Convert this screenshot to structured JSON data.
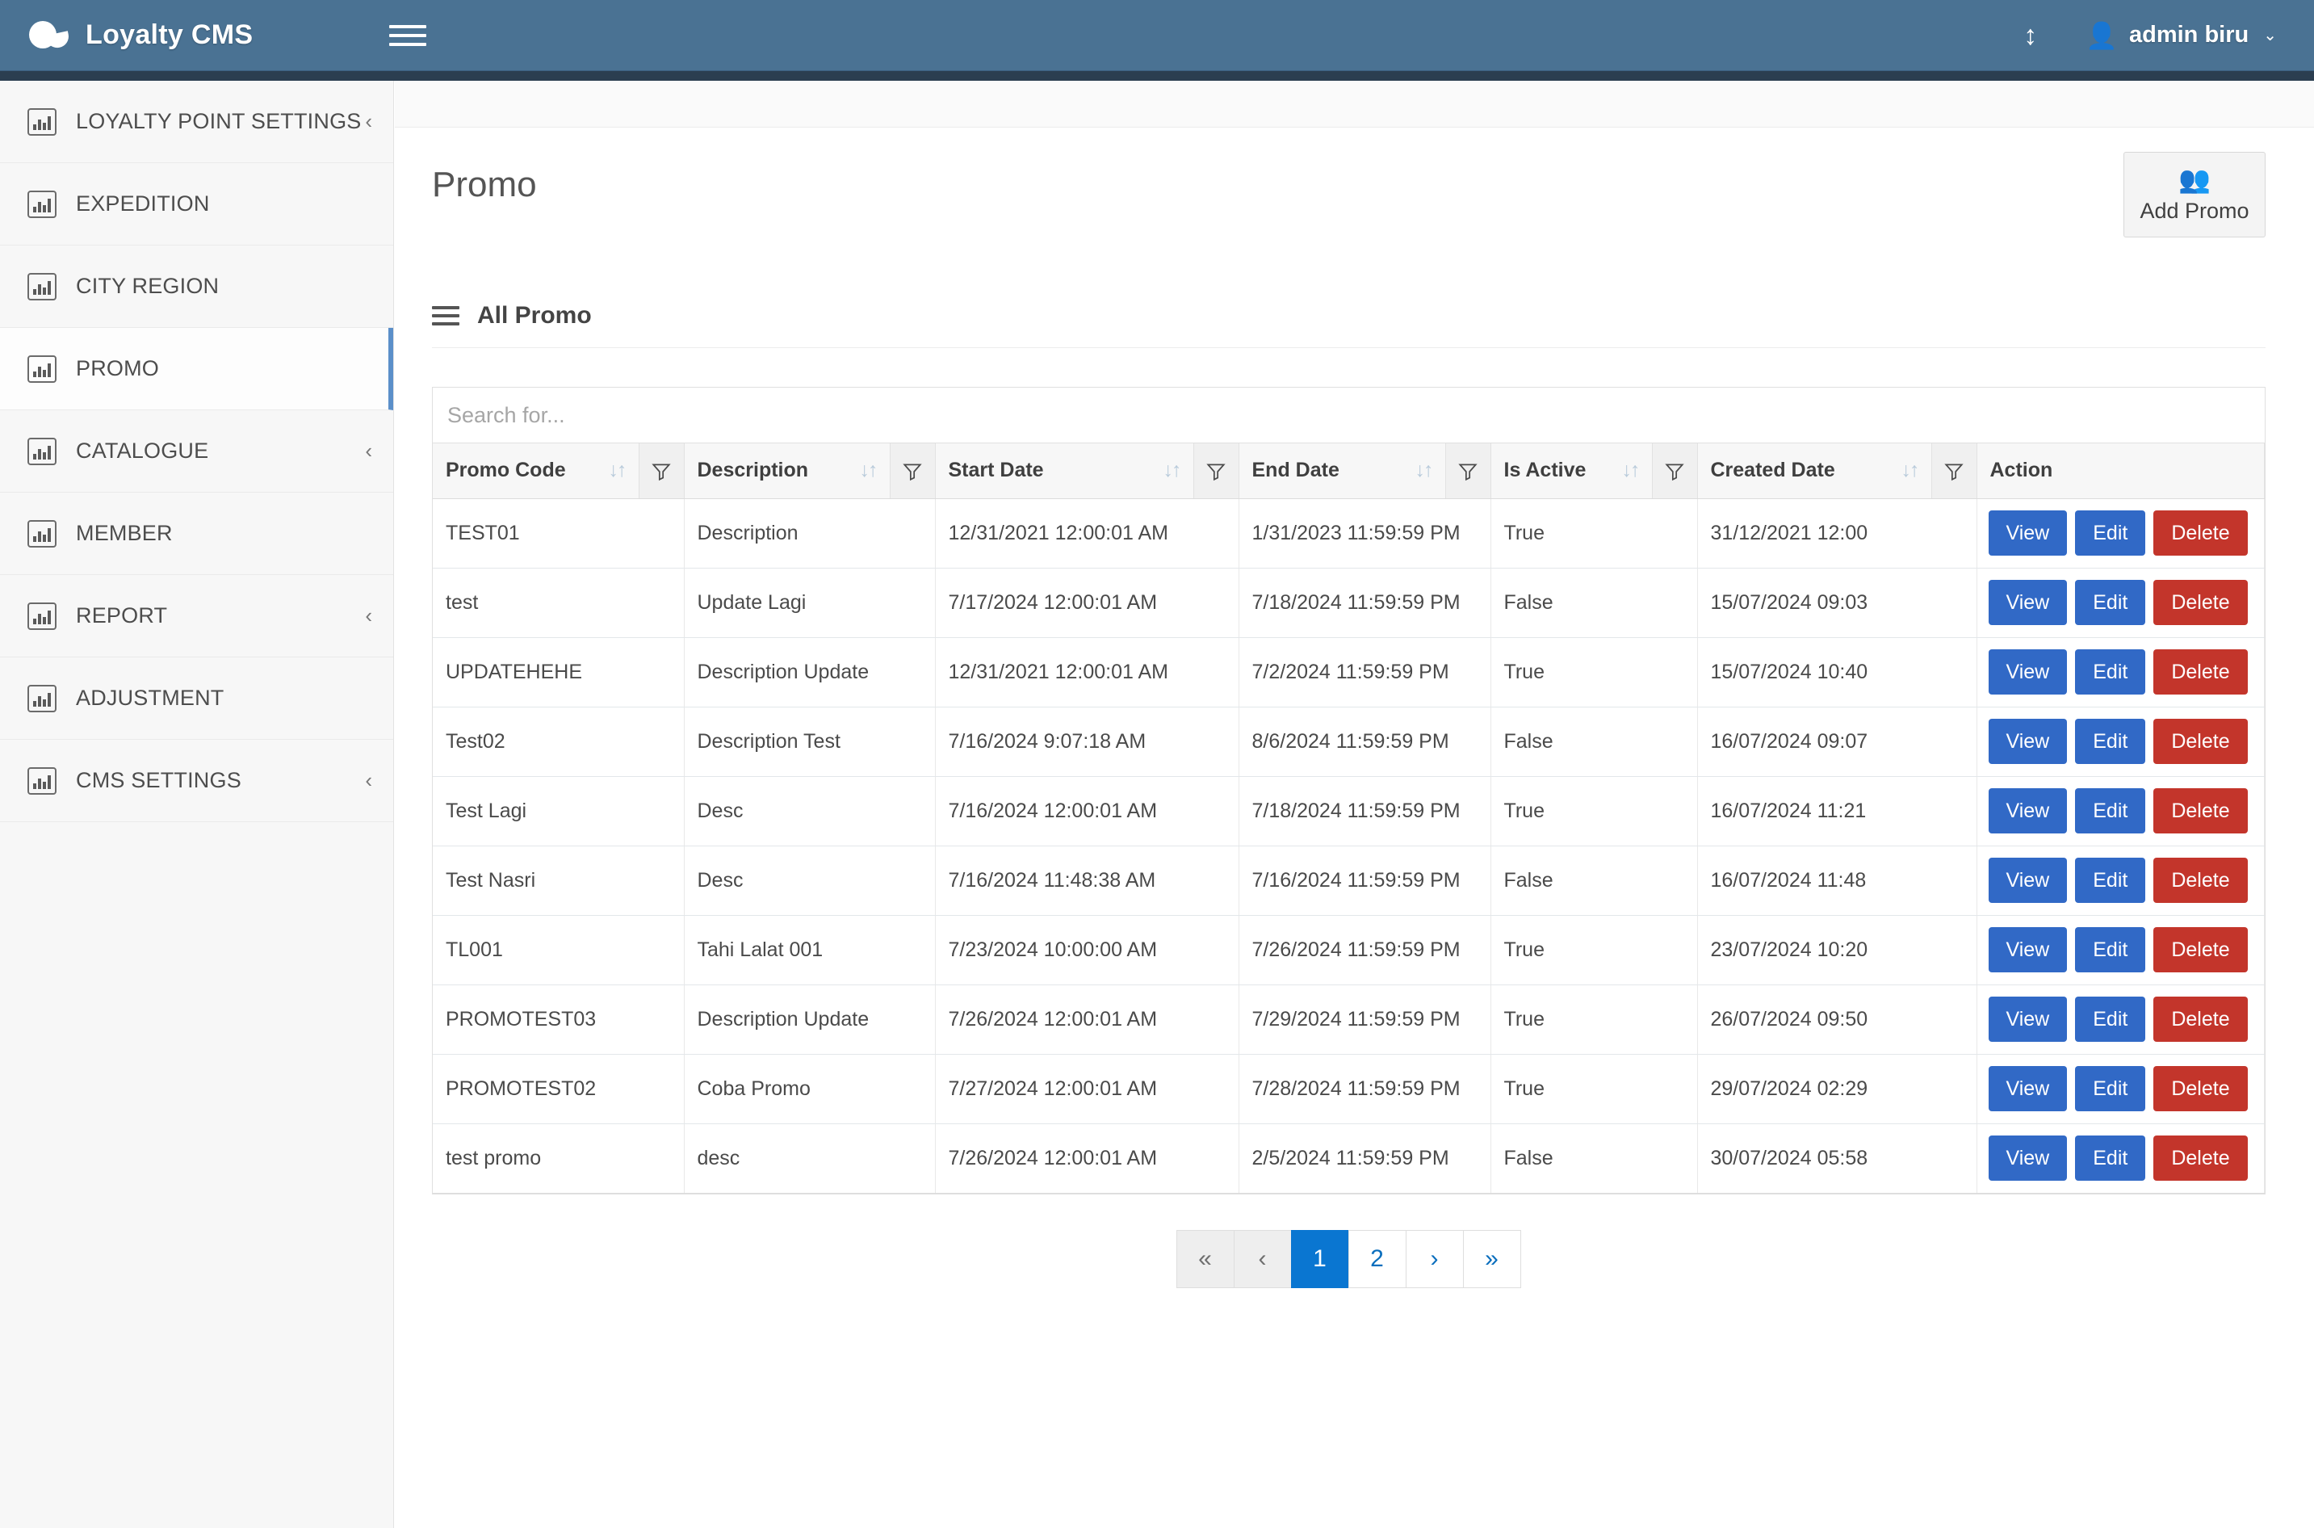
{
  "topbar": {
    "brand": "Loyalty CMS",
    "menu_toggle_icon": "hamburger-icon",
    "resize_icon": "↕",
    "user_icon": "\u0001",
    "user_name": "admin biru",
    "caret": "⌄"
  },
  "sidebar": {
    "items": [
      {
        "label": "LOYALTY POINT SETTINGS",
        "chevron": "‹",
        "has_children": true,
        "active": false
      },
      {
        "label": "EXPEDITION",
        "chevron": "",
        "has_children": false,
        "active": false
      },
      {
        "label": "CITY REGION",
        "chevron": "",
        "has_children": false,
        "active": false
      },
      {
        "label": "PROMO",
        "chevron": "",
        "has_children": false,
        "active": true
      },
      {
        "label": "CATALOGUE",
        "chevron": "‹",
        "has_children": true,
        "active": false
      },
      {
        "label": "MEMBER",
        "chevron": "",
        "has_children": false,
        "active": false
      },
      {
        "label": "REPORT",
        "chevron": "‹",
        "has_children": true,
        "active": false
      },
      {
        "label": "ADJUSTMENT",
        "chevron": "",
        "has_children": false,
        "active": false
      },
      {
        "label": "CMS SETTINGS",
        "chevron": "‹",
        "has_children": true,
        "active": false
      }
    ]
  },
  "page": {
    "title": "Promo",
    "add_button_label": "Add Promo",
    "add_button_icon": "users-group-icon"
  },
  "card": {
    "title": "All Promo"
  },
  "search": {
    "value": "",
    "placeholder": "Search for..."
  },
  "table": {
    "columns": [
      {
        "label": "Promo Code",
        "sortable": true,
        "filter": true
      },
      {
        "label": "Description",
        "sortable": true,
        "filter": true
      },
      {
        "label": "Start Date",
        "sortable": true,
        "filter": true
      },
      {
        "label": "End Date",
        "sortable": true,
        "filter": true
      },
      {
        "label": "Is Active",
        "sortable": true,
        "filter": true
      },
      {
        "label": "Created Date",
        "sortable": true,
        "filter": true
      },
      {
        "label": "Action",
        "sortable": false,
        "filter": false
      }
    ],
    "actions": {
      "view": "View",
      "edit": "Edit",
      "delete": "Delete"
    },
    "rows": [
      {
        "promo_code": "TEST01",
        "description": "Description",
        "start_date": "12/31/2021 12:00:01 AM",
        "end_date": "1/31/2023 11:59:59 PM",
        "is_active": "True",
        "created_date": "31/12/2021 12:00"
      },
      {
        "promo_code": "test",
        "description": "Update Lagi",
        "start_date": "7/17/2024 12:00:01 AM",
        "end_date": "7/18/2024 11:59:59 PM",
        "is_active": "False",
        "created_date": "15/07/2024 09:03"
      },
      {
        "promo_code": "UPDATEHEHE",
        "description": "Description Update",
        "start_date": "12/31/2021 12:00:01 AM",
        "end_date": "7/2/2024 11:59:59 PM",
        "is_active": "True",
        "created_date": "15/07/2024 10:40"
      },
      {
        "promo_code": "Test02",
        "description": "Description Test",
        "start_date": "7/16/2024 9:07:18 AM",
        "end_date": "8/6/2024 11:59:59 PM",
        "is_active": "False",
        "created_date": "16/07/2024 09:07"
      },
      {
        "promo_code": "Test Lagi",
        "description": "Desc",
        "start_date": "7/16/2024 12:00:01 AM",
        "end_date": "7/18/2024 11:59:59 PM",
        "is_active": "True",
        "created_date": "16/07/2024 11:21"
      },
      {
        "promo_code": "Test Nasri",
        "description": "Desc",
        "start_date": "7/16/2024 11:48:38 AM",
        "end_date": "7/16/2024 11:59:59 PM",
        "is_active": "False",
        "created_date": "16/07/2024 11:48"
      },
      {
        "promo_code": "TL001",
        "description": "Tahi Lalat 001",
        "start_date": "7/23/2024 10:00:00 AM",
        "end_date": "7/26/2024 11:59:59 PM",
        "is_active": "True",
        "created_date": "23/07/2024 10:20"
      },
      {
        "promo_code": "PROMOTEST03",
        "description": "Description Update",
        "start_date": "7/26/2024 12:00:01 AM",
        "end_date": "7/29/2024 11:59:59 PM",
        "is_active": "True",
        "created_date": "26/07/2024 09:50"
      },
      {
        "promo_code": "PROMOTEST02",
        "description": "Coba Promo",
        "start_date": "7/27/2024 12:00:01 AM",
        "end_date": "7/28/2024 11:59:59 PM",
        "is_active": "True",
        "created_date": "29/07/2024 02:29"
      },
      {
        "promo_code": "test promo",
        "description": "desc",
        "start_date": "7/26/2024 12:00:01 AM",
        "end_date": "2/5/2024 11:59:59 PM",
        "is_active": "False",
        "created_date": "30/07/2024 05:58"
      }
    ]
  },
  "pagination": {
    "buttons": [
      {
        "label": "«",
        "state": "disabled"
      },
      {
        "label": "‹",
        "state": "disabled"
      },
      {
        "label": "1",
        "state": "active"
      },
      {
        "label": "2",
        "state": "normal"
      },
      {
        "label": "›",
        "state": "normal"
      },
      {
        "label": "»",
        "state": "normal"
      }
    ]
  },
  "colors": {
    "topbar": "#4a7293",
    "topbar_dark": "#2b3e50",
    "accent_blue": "#0a76d1",
    "btn_primary": "#3169c6",
    "btn_danger": "#c3352b",
    "sidebar_active_border": "#5b8fc9"
  }
}
